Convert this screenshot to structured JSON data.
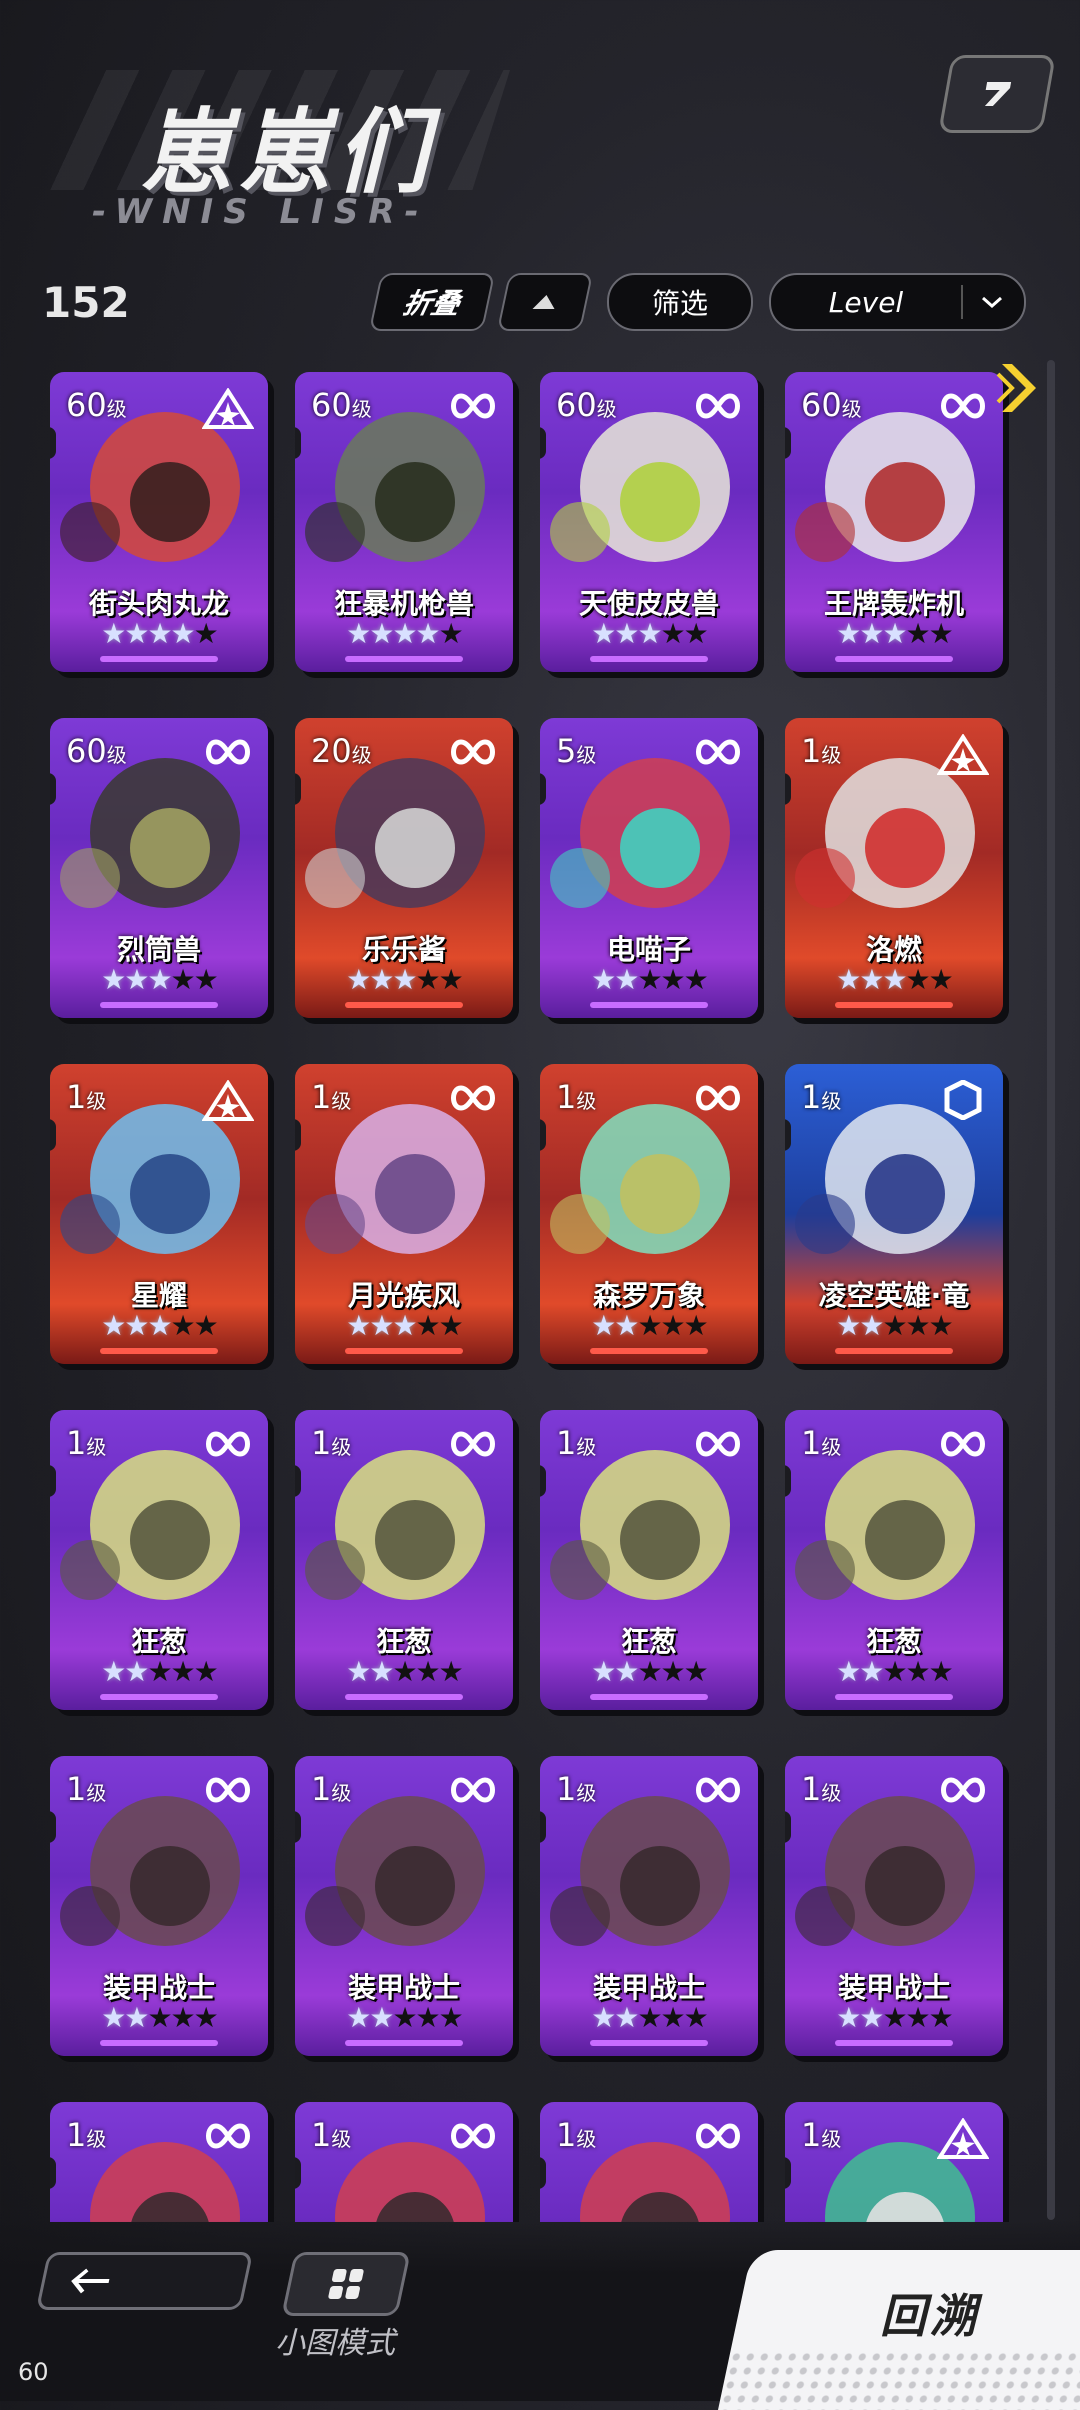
{
  "header": {
    "title": "崽崽们",
    "subtitle": "-WNIS LISR-",
    "share_icon": "share-icon"
  },
  "toolbar": {
    "count": "152",
    "fold_label": "折叠",
    "sort_dir_icon": "triangle-up-icon",
    "filter_label": "筛选",
    "sort_label": "Level",
    "sort_chevron_icon": "chevron-down-icon"
  },
  "cards": [
    {
      "level": "60",
      "unit": "级",
      "name": "街头肉丸龙",
      "badge": "triangle-star",
      "stars": 4,
      "color": "purple"
    },
    {
      "level": "60",
      "unit": "级",
      "name": "狂暴机枪兽",
      "badge": "infinity",
      "stars": 4,
      "color": "purple"
    },
    {
      "level": "60",
      "unit": "级",
      "name": "天使皮皮兽",
      "badge": "infinity",
      "stars": 3,
      "color": "purple"
    },
    {
      "level": "60",
      "unit": "级",
      "name": "王牌轰炸机",
      "badge": "infinity",
      "stars": 3,
      "color": "purple"
    },
    {
      "level": "60",
      "unit": "级",
      "name": "烈筒兽",
      "badge": "infinity",
      "stars": 3,
      "color": "purple"
    },
    {
      "level": "20",
      "unit": "级",
      "name": "乐乐酱",
      "badge": "infinity",
      "stars": 3,
      "color": "red"
    },
    {
      "level": "5",
      "unit": "级",
      "name": "电喵子",
      "badge": "infinity",
      "stars": 2,
      "color": "purple"
    },
    {
      "level": "1",
      "unit": "级",
      "name": "洛燃",
      "badge": "triangle-star",
      "stars": 3,
      "color": "red"
    },
    {
      "level": "1",
      "unit": "级",
      "name": "星耀",
      "badge": "triangle-star",
      "stars": 3,
      "color": "red"
    },
    {
      "level": "1",
      "unit": "级",
      "name": "月光疾风",
      "badge": "infinity",
      "stars": 3,
      "color": "red"
    },
    {
      "level": "1",
      "unit": "级",
      "name": "森罗万象",
      "badge": "infinity",
      "stars": 2,
      "color": "red"
    },
    {
      "level": "1",
      "unit": "级",
      "name": "凌空英雄·竜",
      "badge": "hexagon",
      "stars": 2,
      "color": "blue"
    },
    {
      "level": "1",
      "unit": "级",
      "name": "狂葱",
      "badge": "infinity",
      "stars": 2,
      "color": "purple"
    },
    {
      "level": "1",
      "unit": "级",
      "name": "狂葱",
      "badge": "infinity",
      "stars": 2,
      "color": "purple"
    },
    {
      "level": "1",
      "unit": "级",
      "name": "狂葱",
      "badge": "infinity",
      "stars": 2,
      "color": "purple"
    },
    {
      "level": "1",
      "unit": "级",
      "name": "狂葱",
      "badge": "infinity",
      "stars": 2,
      "color": "purple"
    },
    {
      "level": "1",
      "unit": "级",
      "name": "装甲战士",
      "badge": "infinity",
      "stars": 2,
      "color": "purple"
    },
    {
      "level": "1",
      "unit": "级",
      "name": "装甲战士",
      "badge": "infinity",
      "stars": 2,
      "color": "purple"
    },
    {
      "level": "1",
      "unit": "级",
      "name": "装甲战士",
      "badge": "infinity",
      "stars": 2,
      "color": "purple"
    },
    {
      "level": "1",
      "unit": "级",
      "name": "装甲战士",
      "badge": "infinity",
      "stars": 2,
      "color": "purple"
    },
    {
      "level": "1",
      "unit": "级",
      "name": "",
      "badge": "infinity",
      "stars": 0,
      "color": "purple"
    },
    {
      "level": "1",
      "unit": "级",
      "name": "",
      "badge": "infinity",
      "stars": 0,
      "color": "purple"
    },
    {
      "level": "1",
      "unit": "级",
      "name": "",
      "badge": "infinity",
      "stars": 0,
      "color": "purple"
    },
    {
      "level": "1",
      "unit": "级",
      "name": "",
      "badge": "triangle-star",
      "stars": 0,
      "color": "purple"
    }
  ],
  "footer": {
    "back_icon": "arrow-left-icon",
    "mini_mode_icon": "grid-icon",
    "mini_mode_label": "小图模式",
    "recall_label": "回溯",
    "fps": "60"
  }
}
